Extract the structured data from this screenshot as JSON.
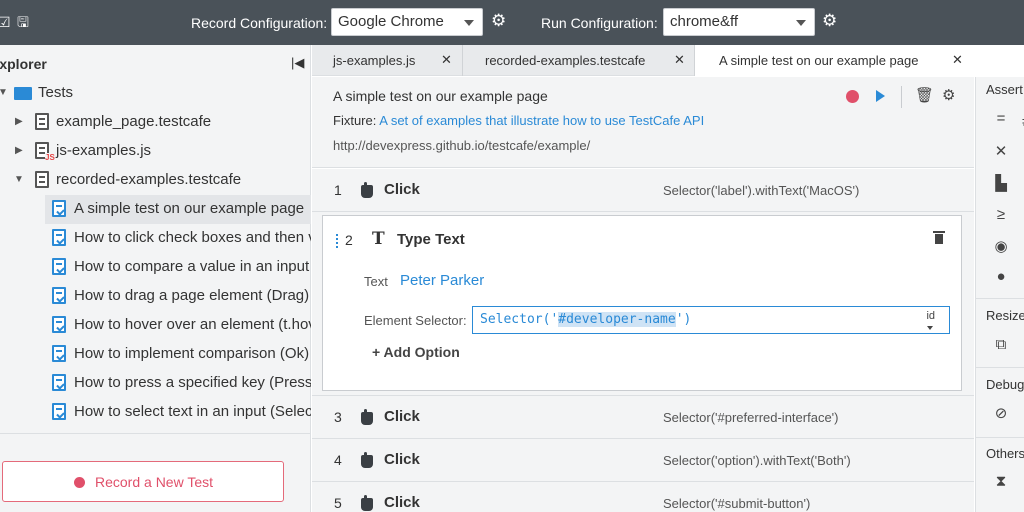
{
  "topbar": {
    "record_config_label": "Record Configuration:",
    "record_config_value": "Google Chrome",
    "run_config_label": "Run Configuration:",
    "run_config_value": "chrome&ff"
  },
  "explorer": {
    "title": "Explorer",
    "tree": [
      {
        "label": "Tests",
        "type": "folder",
        "expanded": true
      },
      {
        "label": "example_page.testcafe",
        "type": "file",
        "expanded": false
      },
      {
        "label": "js-examples.js",
        "type": "js",
        "expanded": false
      },
      {
        "label": "recorded-examples.testcafe",
        "type": "file",
        "expanded": true
      },
      {
        "label": "A simple test on our example page",
        "type": "test",
        "selected": true
      },
      {
        "label": "How to click check boxes and then verify their state",
        "type": "test"
      },
      {
        "label": "How to compare a value in an input field",
        "type": "test"
      },
      {
        "label": "How to drag a page element (Drag)",
        "type": "test"
      },
      {
        "label": "How to hover over an element (t.hover)",
        "type": "test"
      },
      {
        "label": "How to implement comparison (Ok)",
        "type": "test"
      },
      {
        "label": "How to press a specified key (Press Key)",
        "type": "test"
      },
      {
        "label": "How to select text in an input (Select Text)",
        "type": "test"
      }
    ],
    "record_button": "Record a New Test"
  },
  "tabs": [
    {
      "label": "js-examples.js",
      "active": false
    },
    {
      "label": "recorded-examples.testcafe",
      "active": false
    },
    {
      "label": "A simple test on our example page",
      "active": true
    }
  ],
  "test_header": {
    "title": "A simple test on our example page",
    "fixture_label": "Fixture:",
    "fixture_value": "A set of examples that illustrate how to use TestCafe API",
    "url": "http://devexpress.github.io/testcafe/example/"
  },
  "steps": [
    {
      "num": "1",
      "name": "Click",
      "selector": "Selector('label').withText('MacOS')"
    },
    {
      "num": "2",
      "name": "Type Text",
      "text_label": "Text",
      "text_value": "Peter Parker",
      "selector_label": "Element Selector:",
      "selector_pre": "Selector('",
      "selector_hl": "#developer-name",
      "selector_post": "')",
      "selector_type": "id",
      "add_option": "+ Add Option"
    },
    {
      "num": "3",
      "name": "Click",
      "selector": "Selector('#preferred-interface')"
    },
    {
      "num": "4",
      "name": "Click",
      "selector": "Selector('option').withText('Both')"
    },
    {
      "num": "5",
      "name": "Click",
      "selector": "Selector('#submit-button')"
    }
  ],
  "right_panel": {
    "assertions": "Assert",
    "resize": "Resize",
    "debug": "Debug",
    "others": "Others"
  },
  "colors": {
    "accent": "#2a8ad6",
    "record": "#e0506a",
    "topbar": "#4a5259"
  }
}
